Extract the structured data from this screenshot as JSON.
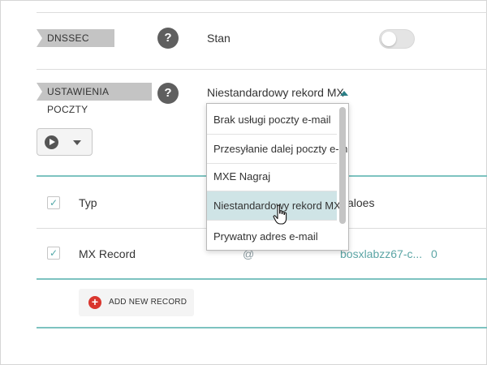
{
  "dnssec": {
    "tag": "DNSSEC",
    "help": "?",
    "state_label": "Stan",
    "toggle_on": false
  },
  "mail": {
    "tag": "USTAWIENIA POCZTY",
    "help": "?",
    "selected": "Niestandardowy rekord MX",
    "options": [
      "Brak usługi poczty e-mail",
      "Przesyłanie dalej poczty e-mail",
      "MXE  Nagraj",
      "Niestandardowy rekord MX",
      "Prywatny adres e-mail"
    ],
    "hovered_index": 3
  },
  "toolbar": {
    "play_icon": "play-circle-icon",
    "dropdown_icon": "caret-down-icon"
  },
  "table": {
    "headers": [
      "Typ",
      "aloes"
    ],
    "rows": [
      {
        "type": "MX Record",
        "host": "@",
        "value": "bosxlabzz67-c...",
        "priority": "0",
        "checked": true
      }
    ]
  },
  "add_record": {
    "icon": "plus-icon",
    "plus": "+",
    "label": "ADD NEW RECORD"
  },
  "colors": {
    "accent": "#7dc3c0",
    "link": "#5ba5a5",
    "help_bg": "#5f5f5f",
    "add_icon": "#d9362e"
  }
}
